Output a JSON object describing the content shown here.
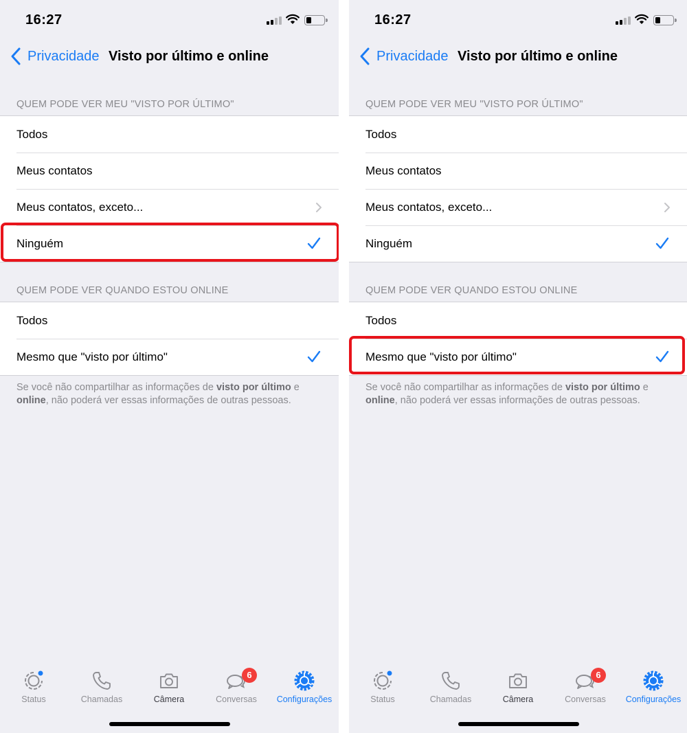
{
  "panels": [
    {
      "status_time": "16:27",
      "nav": {
        "back_label": "Privacidade",
        "title": "Visto por último e online"
      },
      "section1_header": "QUEM PODE VER MEU \"VISTO POR ÚLTIMO\"",
      "section1_items": [
        "Todos",
        "Meus contatos",
        "Meus contatos, exceto...",
        "Ninguém"
      ],
      "section1_selected": "Ninguém",
      "section2_header": "QUEM PODE VER QUANDO ESTOU ONLINE",
      "section2_items": [
        "Todos",
        "Mesmo que \"visto por último\""
      ],
      "section2_selected": "Mesmo que \"visto por último\"",
      "footnote": {
        "part1": "Se você não compartilhar as informações de ",
        "bold1": "visto por último",
        "part2": " e ",
        "bold2": "online",
        "part3": ", não poderá ver essas informações de outras pessoas."
      },
      "highlighted_row": "Ninguém",
      "tabs": [
        "Status",
        "Chamadas",
        "Câmera",
        "Conversas",
        "Configurações"
      ],
      "active_tab": "Configurações",
      "conversas_badge": "6"
    },
    {
      "status_time": "16:27",
      "nav": {
        "back_label": "Privacidade",
        "title": "Visto por último e online"
      },
      "section1_header": "QUEM PODE VER MEU \"VISTO POR ÚLTIMO\"",
      "section1_items": [
        "Todos",
        "Meus contatos",
        "Meus contatos, exceto...",
        "Ninguém"
      ],
      "section1_selected": "Ninguém",
      "section2_header": "QUEM PODE VER QUANDO ESTOU ONLINE",
      "section2_items": [
        "Todos",
        "Mesmo que \"visto por último\""
      ],
      "section2_selected": "Mesmo que \"visto por último\"",
      "footnote": {
        "part1": "Se você não compartilhar as informações de ",
        "bold1": "visto por último",
        "part2": " e ",
        "bold2": "online",
        "part3": ", não poderá ver essas informações de outras pessoas."
      },
      "highlighted_row": "Mesmo que \"visto por último\"",
      "tabs": [
        "Status",
        "Chamadas",
        "Câmera",
        "Conversas",
        "Configurações"
      ],
      "active_tab": "Configurações",
      "conversas_badge": "6"
    }
  ],
  "colors": {
    "accent": "#1a7cf5",
    "highlight_border": "#e8141b",
    "badge": "#f23d3a",
    "background": "#efeff4",
    "secondary_text": "#8a8a8e"
  },
  "icons": {
    "back": "chevron-left-icon",
    "check": "checkmark-icon",
    "disclosure": "chevron-right-icon",
    "tabs": [
      "status-icon",
      "phone-icon",
      "camera-icon",
      "chat-bubbles-icon",
      "gear-icon"
    ]
  }
}
